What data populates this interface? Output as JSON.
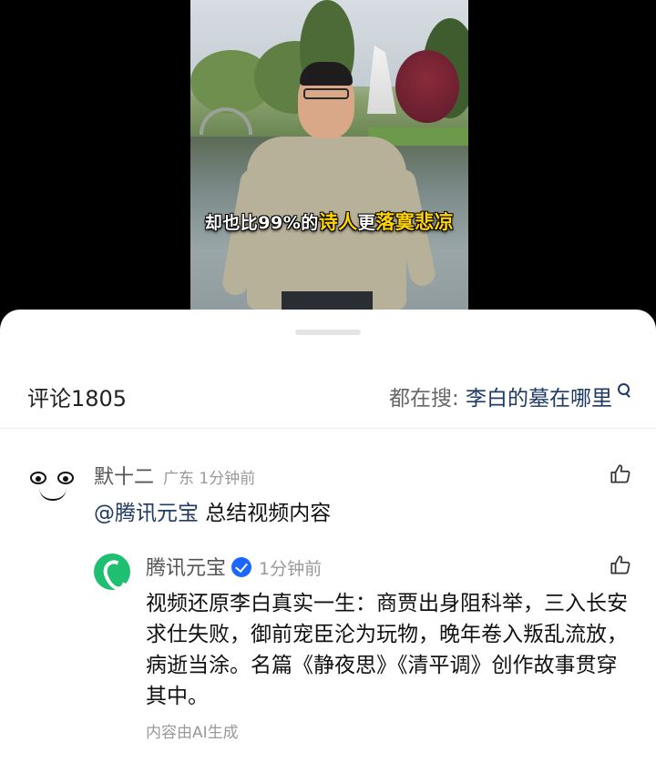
{
  "video": {
    "subtitle_pre": "却也比99%的",
    "subtitle_hl1": "诗人",
    "subtitle_mid": "更",
    "subtitle_hl2": "落寞悲凉"
  },
  "comments_panel": {
    "title": "评论1805",
    "search_prefix": "都在搜: ",
    "search_query": "李白的墓在哪里"
  },
  "comments": [
    {
      "user": "默十二",
      "meta": "广东 1分钟前",
      "mention": "@腾讯元宝",
      "text": " 总结视频内容",
      "reply": {
        "user": "腾讯元宝",
        "meta": "1分钟前",
        "text": "视频还原李白真实一生：商贾出身阻科举，三入长安求仕失败，御前宠臣沦为玩物，晚年卷入叛乱流放，病逝当涂。名篇《静夜思》《清平调》创作故事贯穿其中。",
        "footer": "内容由AI生成"
      }
    }
  ],
  "icons": {
    "like": "thumbs-up-icon",
    "search": "search-icon",
    "verified": "verified-badge-icon"
  },
  "colors": {
    "link": "#1f3a66",
    "verified": "#1a66ff",
    "yuanbao_brand": "#1fbf72",
    "subtitle_highlight": "#ffd400"
  }
}
